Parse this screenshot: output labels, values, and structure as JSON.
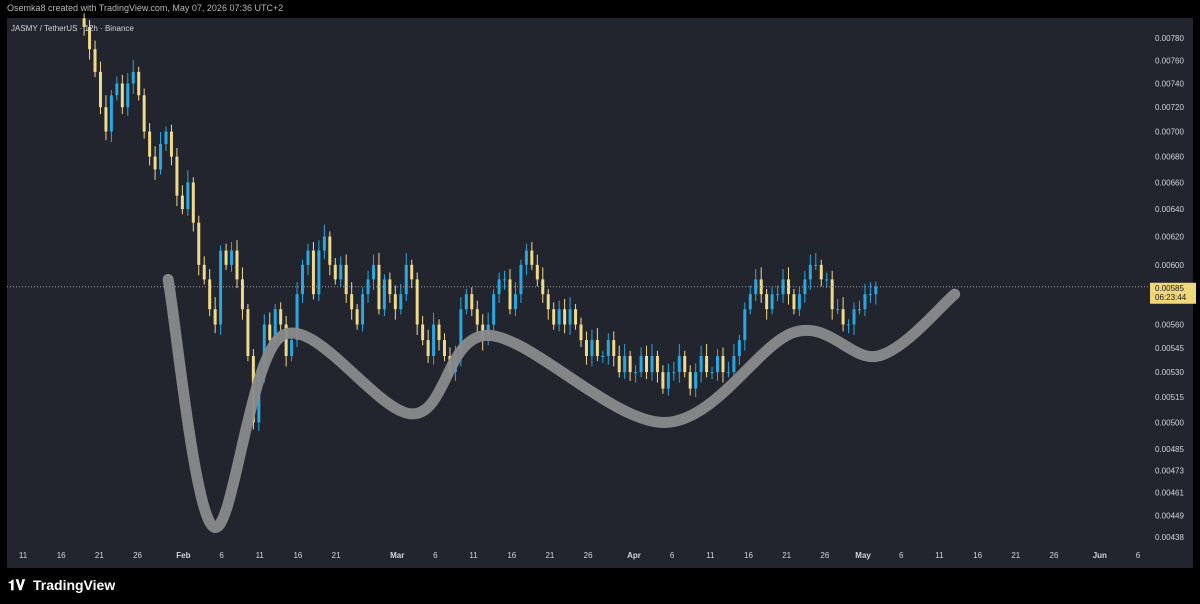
{
  "header": {
    "caption": "Osemka8 created with TradingView.com, May 07, 2026 07:36 UTC+2"
  },
  "chart": {
    "symbol_title": "JASMY / TetherUS · 12h · Binance",
    "last_price": {
      "value": "0.00585",
      "countdown": "06:23:44"
    },
    "colors": {
      "up": "#2aa7e0",
      "down": "#efd98a",
      "label_bg": "#f0d77a",
      "drawing": "#8a8a8c"
    }
  },
  "footer": {
    "brand": "TradingView"
  },
  "chart_data": {
    "type": "candlestick",
    "title": "JASMY / TetherUS · 12h · Binance",
    "y_axis": {
      "ticks": [
        "0.00780",
        "0.00760",
        "0.00740",
        "0.00720",
        "0.00700",
        "0.00680",
        "0.00660",
        "0.00640",
        "0.00620",
        "0.00600",
        "0.00560",
        "0.00545",
        "0.00530",
        "0.00515",
        "0.00500",
        "0.00485",
        "0.00473",
        "0.00461",
        "0.00449",
        "0.00438"
      ],
      "scale": "log",
      "range": [
        0.0043,
        0.008
      ]
    },
    "x_axis": {
      "ticks": [
        "11",
        "16",
        "21",
        "26",
        "Feb",
        "6",
        "11",
        "16",
        "21",
        "Mar",
        "6",
        "11",
        "16",
        "21",
        "26",
        "Apr",
        "6",
        "11",
        "16",
        "21",
        "26",
        "May",
        "6",
        "11",
        "16",
        "21",
        "26",
        "Jun",
        "6"
      ],
      "start_date": "2026-01-11",
      "end_date": "2026-06-06"
    },
    "last_price": 0.00585,
    "series": [
      {
        "interval": "12h",
        "close": [
          0.0079,
          0.0077,
          0.0075,
          0.0072,
          0.007,
          0.0073,
          0.0074,
          0.0072,
          0.0074,
          0.0075,
          0.0073,
          0.007,
          0.0068,
          0.0067,
          0.0069,
          0.007,
          0.0068,
          0.0065,
          0.0064,
          0.0066,
          0.0063,
          0.006,
          0.0059,
          0.0057,
          0.0056,
          0.0061,
          0.006,
          0.0061,
          0.0059,
          0.0057,
          0.0054,
          0.005,
          0.0053,
          0.0056,
          0.0055,
          0.0057,
          0.0056,
          0.0054,
          0.0055,
          0.0058,
          0.006,
          0.0061,
          0.0058,
          0.0061,
          0.0062,
          0.006,
          0.0059,
          0.006,
          0.0058,
          0.0057,
          0.0056,
          0.0058,
          0.0059,
          0.006,
          0.0057,
          0.0059,
          0.0058,
          0.0057,
          0.0058,
          0.006,
          0.0059,
          0.0056,
          0.0055,
          0.0054,
          0.0056,
          0.0055,
          0.0054,
          0.0053,
          0.0054,
          0.0057,
          0.0058,
          0.0057,
          0.0056,
          0.0055,
          0.0056,
          0.0058,
          0.0059,
          0.0059,
          0.0057,
          0.0058,
          0.006,
          0.0061,
          0.006,
          0.0059,
          0.0058,
          0.0057,
          0.0056,
          0.0057,
          0.0056,
          0.0057,
          0.0056,
          0.0055,
          0.0054,
          0.0055,
          0.0054,
          0.0054,
          0.0055,
          0.0054,
          0.0053,
          0.0054,
          0.0053,
          0.0053,
          0.0054,
          0.0053,
          0.0054,
          0.0053,
          0.0052,
          0.0053,
          0.0053,
          0.0054,
          0.0053,
          0.0052,
          0.0053,
          0.0054,
          0.0053,
          0.0053,
          0.0054,
          0.0053,
          0.0053,
          0.0054,
          0.0055,
          0.0057,
          0.0058,
          0.0059,
          0.0058,
          0.0057,
          0.0058,
          0.0058,
          0.0059,
          0.0058,
          0.0057,
          0.0058,
          0.0059,
          0.006,
          0.006,
          0.0059,
          0.0059,
          0.0057,
          0.0057,
          0.0056,
          0.0056,
          0.0057,
          0.0057,
          0.0058,
          0.0058,
          0.00585
        ]
      }
    ],
    "drawing": {
      "type": "freehand",
      "description_points": [
        {
          "date": "2026-01-30",
          "price": 0.0059
        },
        {
          "date": "2026-02-05",
          "price": 0.00443
        },
        {
          "date": "2026-02-14",
          "price": 0.00553
        },
        {
          "date": "2026-03-03",
          "price": 0.00505
        },
        {
          "date": "2026-03-13",
          "price": 0.00553
        },
        {
          "date": "2026-04-05",
          "price": 0.005
        },
        {
          "date": "2026-04-22",
          "price": 0.00555
        },
        {
          "date": "2026-05-03",
          "price": 0.0054
        },
        {
          "date": "2026-05-13",
          "price": 0.0058
        }
      ]
    }
  }
}
